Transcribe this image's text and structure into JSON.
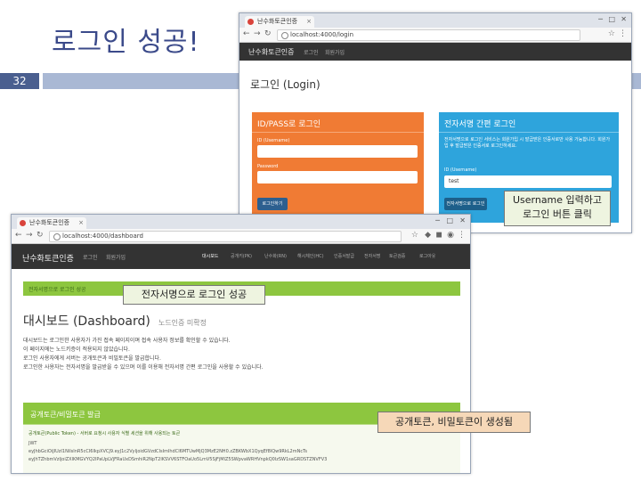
{
  "slide": {
    "title": "로그인 성공!",
    "number": "32"
  },
  "login_window": {
    "tab_title": "난수화토큰인증",
    "url": "localhost:4000/login",
    "nav": {
      "brand": "난수화토큰인증",
      "links": [
        "로그인",
        "회원가입"
      ]
    },
    "page_title": "로그인 (Login)",
    "id_card": {
      "title": "ID/PASS로 로그인",
      "id_label": "ID (Username)",
      "pw_label": "Password",
      "button": "로그인하기"
    },
    "cert_card": {
      "title": "전자서명 간편 로그인",
      "desc": "전자서명으로 로그인 서비스는 회원가입 시 발급받은 인증서로만 사용 가능합니다. 회원가입 후 발급받은 인증서로 로그인하세요.",
      "id_label": "ID (Username)",
      "id_value": "test",
      "button": "전자서명으로 로그인"
    },
    "colors": {
      "id_card": "#f07b34",
      "cert_card": "#2ea4dc",
      "navbar": "#333333"
    }
  },
  "dashboard_window": {
    "tab_title": "난수화토큰인증",
    "url": "localhost:4000/dashboard",
    "nav": {
      "brand": "난수화토큰인증",
      "links": [
        "로그인",
        "회원가입"
      ],
      "right_links": [
        "대시보드",
        "공개키(PK)",
        "난수화(RN)",
        "해시체인(HC)",
        "인증서발급",
        "전자서명",
        "토큰검증",
        "로그아웃"
      ]
    },
    "alert": "전자서명으로 로그인 성공",
    "page_title": "대시보드 (Dashboard)",
    "page_title_sub": "노드인증 미확정",
    "paragraphs": [
      "대시보드는 로그인한 사용자가 가진 접속 페이지이며 접속 사용자 정보를 확인할 수 있습니다.",
      "이 페이지에는 노드키증이 적용되지 않았습니다.",
      "로그인 사용자에게 서버는 공개토큰과 비밀토큰을 발급합니다.",
      "로그인한 사용자는 전자서명을 발급받을 수 있으며 이를 이용해 전자서명 간편 로그인을 사용할 수 있습니다."
    ],
    "token_panel": {
      "title": "공개토큰/비밀토큰 발급",
      "public_label": "공개토큰(Public Token) - 서버로 요청시 사용자 식별 세션을 위해 사용되는 토큰",
      "label_prefix": "JWT",
      "lines": [
        "eyJhbGciOiJIUzI1NiIsInR5cCI6IkpXVCJ9.eyJ1c2VyIjoidGVzdCIsImlhdCI6MTUwMjQ3MzE2NH0.zZBKWbX1QyqEf8lQw9RkL2mNcTs",
        "eyJhTZhbmVzIjoiZXlKMGVYQ2lPaUpLVjFRaUxDSmhiR2NpT2lKSVV6STFOaUo5LmV5SjFjMlZ5SWpvaWRHVnpkQ0lzSW1saGRDSTZNVFV3"
      ]
    },
    "colors": {
      "alert_bg": "#8dc63f",
      "alert_text": "#3c6b1a",
      "panel_bg": "#8dc63f"
    }
  },
  "callouts": {
    "username": [
      "Username 입력하고",
      "로그인 버튼 클릭"
    ],
    "login_success": "전자서명으로 로그인 성공",
    "tokens": "공개토큰, 비밀토큰이 생성됨"
  }
}
